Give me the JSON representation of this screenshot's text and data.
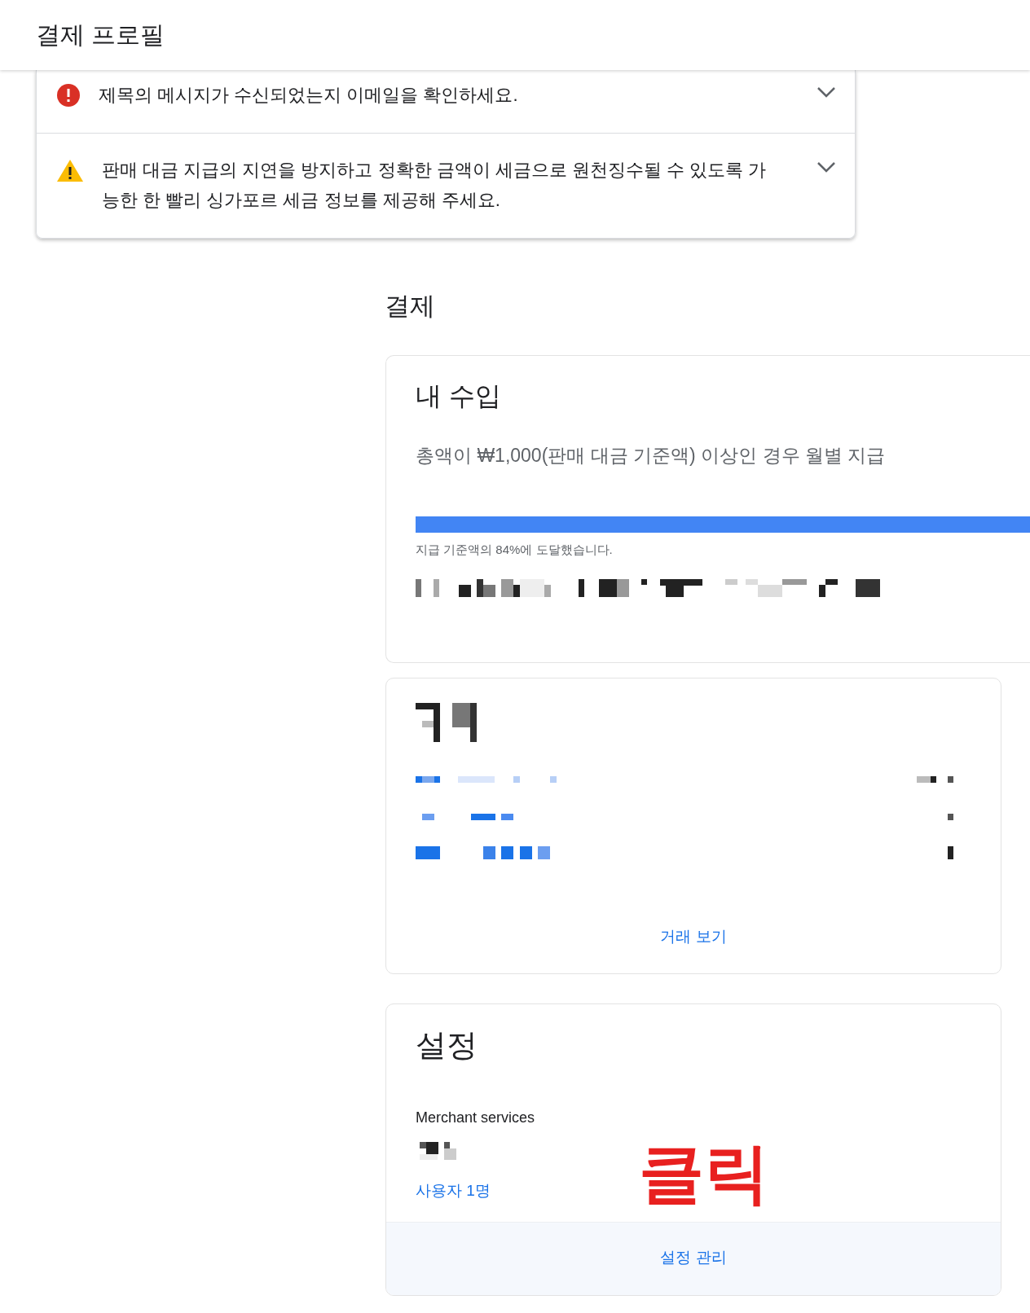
{
  "header": {
    "title": "결제 프로필"
  },
  "alerts": [
    {
      "kind": "error",
      "text": "제목의 메시지가 수신되었는지 이메일을 확인하세요.",
      "expanded": false
    },
    {
      "kind": "warning",
      "text": "판매 대금 지급의 지연을 방지하고 정확한 금액이 세금으로 원천징수될 수 있도록 가능한 한 빨리 싱가포르 세금 정보를 제공해 주세요.",
      "expanded": false
    }
  ],
  "section_title": "결제",
  "earnings": {
    "title": "내 수입",
    "description": "총액이 ₩1,000(판매 대금 기준액) 이상인 경우 월별 지급",
    "progress": {
      "level": 0.84
    },
    "caption": "지급 기준액의 84%에 도달했습니다."
  },
  "transactions": {
    "link": "거래 보기"
  },
  "settings": {
    "title": "설정",
    "label": "Merchant services",
    "users_link": "사용자 1명",
    "manage_link": "설정 관리"
  },
  "annotation": {
    "text": "클릭"
  }
}
